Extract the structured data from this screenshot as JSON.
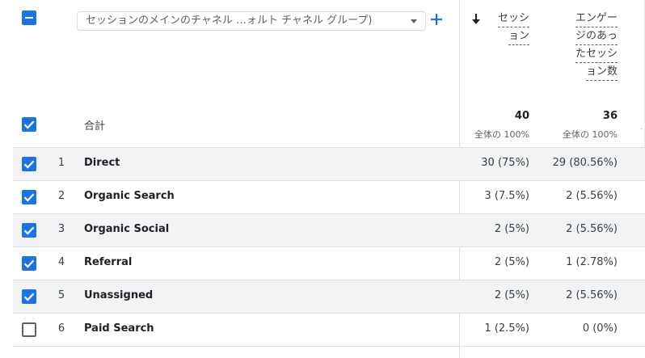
{
  "header": {
    "dimension_select_value": "セッションのメインのチャネル …ォルト チャネル グループ)",
    "metric_columns": [
      {
        "lines": [
          "セッシ",
          "ョン"
        ],
        "sorted": true
      },
      {
        "lines": [
          "エンゲー",
          "ジのあっ",
          "たセッシ",
          "ョン数"
        ],
        "sorted": false
      }
    ]
  },
  "totals": {
    "label": "合計",
    "values": [
      {
        "value": "40",
        "sub": "全体の 100%"
      },
      {
        "value": "36",
        "sub": "全体の 100%"
      }
    ]
  },
  "rows": [
    {
      "index": "1",
      "name": "Direct",
      "sessions": "30 (75%)",
      "engaged": "29 (80.56%)",
      "checked": true
    },
    {
      "index": "2",
      "name": "Organic Search",
      "sessions": "3 (7.5%)",
      "engaged": "2 (5.56%)",
      "checked": true
    },
    {
      "index": "3",
      "name": "Organic Social",
      "sessions": "2 (5%)",
      "engaged": "2 (5.56%)",
      "checked": true
    },
    {
      "index": "4",
      "name": "Referral",
      "sessions": "2 (5%)",
      "engaged": "1 (2.78%)",
      "checked": true
    },
    {
      "index": "5",
      "name": "Unassigned",
      "sessions": "2 (5%)",
      "engaged": "2 (5.56%)",
      "checked": true
    },
    {
      "index": "6",
      "name": "Paid Search",
      "sessions": "1 (2.5%)",
      "engaged": "0 (0%)",
      "checked": false
    }
  ],
  "colors": {
    "accent": "#1a73e8",
    "row_shade": "#f1f3f4",
    "divider": "#dadce0"
  },
  "icons": [
    "minus-checkbox-icon",
    "caret-down-icon",
    "plus-icon",
    "sort-down-arrow-icon",
    "checkbox-icon"
  ]
}
